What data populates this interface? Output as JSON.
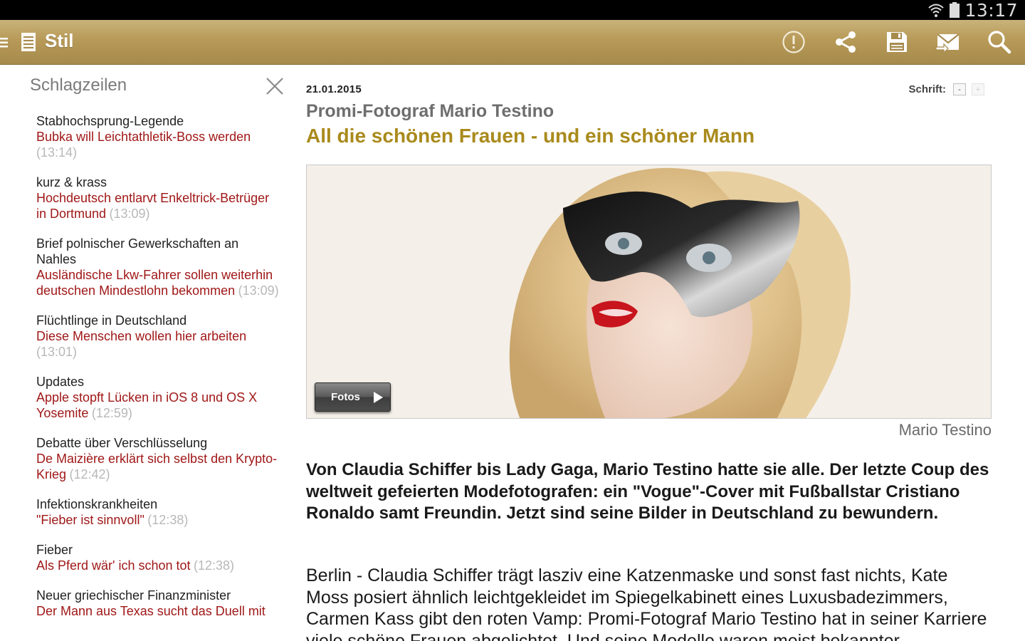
{
  "status_bar": {
    "time": "13:17",
    "icons": [
      "wifi-icon",
      "battery-icon"
    ]
  },
  "action_bar": {
    "title": "Stil",
    "icons": [
      "drawer-icon",
      "document-icon",
      "alert-icon",
      "share-icon",
      "save-icon",
      "mail-icon",
      "search-icon"
    ],
    "colors": {
      "bar": "#b89a58",
      "icon": "#ffffff"
    }
  },
  "sidebar": {
    "title": "Schlagzeilen",
    "items": [
      {
        "kicker": "Stabhochsprung-Legende",
        "title": "Bubka will Leichtathletik-Boss werden",
        "time": "(13:14)"
      },
      {
        "kicker": "kurz & krass",
        "title": "Hochdeutsch entlarvt Enkeltrick-Betrüger in Dortmund",
        "time": "(13:09)"
      },
      {
        "kicker": "Brief polnischer Gewerkschaften an Nahles",
        "title": "Ausländische Lkw-Fahrer sollen weiterhin deutschen Mindestlohn bekommen",
        "time": "(13:09)"
      },
      {
        "kicker": "Flüchtlinge in Deutschland",
        "title": "Diese Menschen wollen hier arbeiten",
        "time": "(13:01)"
      },
      {
        "kicker": "Updates",
        "title": "Apple stopft Lücken in iOS 8 und OS X Yosemite",
        "time": "(12:59)"
      },
      {
        "kicker": "Debatte über Verschlüsselung",
        "title": "De Maizière erklärt sich selbst den Krypto-Krieg",
        "time": "(12:42)"
      },
      {
        "kicker": "Infektionskrankheiten",
        "title": "\"Fieber ist sinnvoll\"",
        "time": "(12:38)"
      },
      {
        "kicker": "Fieber",
        "title": "Als Pferd wär' ich schon tot",
        "time": "(12:38)"
      },
      {
        "kicker": "Neuer griechischer Finanzminister",
        "title": "Der Mann aus Texas sucht das Duell mit",
        "time": ""
      }
    ],
    "colors": {
      "title": "#a01818",
      "time": "#b8b8b8"
    }
  },
  "article": {
    "date": "21.01.2015",
    "font_label": "Schrift:",
    "font_minus": "-",
    "font_plus": "+",
    "kicker": "Promi-Fotograf Mario Testino",
    "headline": "All die schönen Frauen - und ein schöner Mann",
    "photo_button": "Fotos",
    "photo_credit": "Mario Testino",
    "lead": "Von Claudia Schiffer bis Lady Gaga, Mario Testino hatte sie alle. Der letzte Coup des weltweit gefeierten Modefotografen: ein \"Vogue\"-Cover mit Fußballstar Cristiano Ronaldo samt Freundin. Jetzt sind seine Bilder in Deutschland zu bewundern.",
    "body": "Berlin - Claudia Schiffer trägt lasziv eine Katzenmaske und sonst fast nichts, Kate Moss posiert ähnlich leichtgekleidet im Spiegelkabinett eines Luxusbadezimmers, Carmen Kass gibt den roten Vamp: Promi-Fotograf Mario Testino hat in seiner Karriere viele schöne Frauen abgelichtet. Und seine Modelle waren meist bekannter",
    "colors": {
      "headline": "#a98a1c",
      "kicker": "#6e6e6e"
    }
  }
}
